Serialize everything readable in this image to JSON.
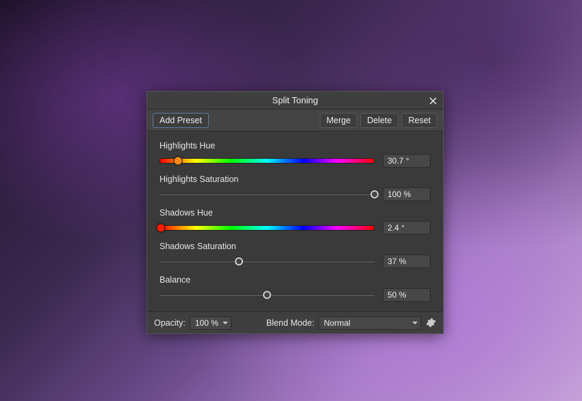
{
  "title": "Split Toning",
  "toolbar": {
    "addPreset": "Add Preset",
    "merge": "Merge",
    "delete": "Delete",
    "reset": "Reset"
  },
  "sliders": {
    "highlightsHue": {
      "label": "Highlights Hue",
      "value": "30.7 °",
      "pos": 8.5,
      "thumbColor": "#ff8a1a",
      "type": "hue"
    },
    "highlightsSaturation": {
      "label": "Highlights Saturation",
      "value": "100 %",
      "pos": 100,
      "type": "ring"
    },
    "shadowsHue": {
      "label": "Shadows Hue",
      "value": "2.4 °",
      "pos": 0.7,
      "thumbColor": "#ff1a00",
      "type": "hue"
    },
    "shadowsSaturation": {
      "label": "Shadows Saturation",
      "value": "37 %",
      "pos": 37,
      "type": "ring"
    },
    "balance": {
      "label": "Balance",
      "value": "50 %",
      "pos": 50,
      "type": "ring"
    }
  },
  "footer": {
    "opacityLabel": "Opacity:",
    "opacityValue": "100 %",
    "blendLabel": "Blend Mode:",
    "blendValue": "Normal"
  }
}
